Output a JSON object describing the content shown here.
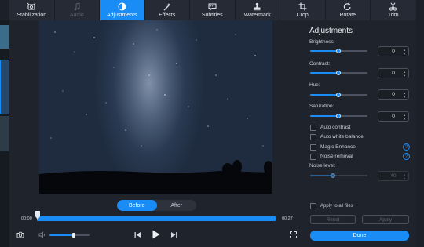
{
  "tabs": [
    {
      "label": "Stabilization",
      "icon": "stabilization-icon",
      "state": "normal"
    },
    {
      "label": "Audio",
      "icon": "music-note-icon",
      "state": "disabled"
    },
    {
      "label": "Adjustments",
      "icon": "adjustments-icon",
      "state": "active"
    },
    {
      "label": "Effects",
      "icon": "magic-wand-icon",
      "state": "normal"
    },
    {
      "label": "Subtitles",
      "icon": "speech-bubble-icon",
      "state": "normal"
    },
    {
      "label": "Watermark",
      "icon": "stamp-icon",
      "state": "normal"
    },
    {
      "label": "Crop",
      "icon": "crop-icon",
      "state": "normal"
    },
    {
      "label": "Rotate",
      "icon": "rotate-icon",
      "state": "normal"
    },
    {
      "label": "Trim",
      "icon": "scissors-icon",
      "state": "normal"
    }
  ],
  "preview": {
    "before_label": "Before",
    "after_label": "After",
    "selected": "Before"
  },
  "player": {
    "time_start": "00:00",
    "time_end": "00:27",
    "volume_level": 0.6
  },
  "adjustments": {
    "title": "Adjustments",
    "sliders": [
      {
        "label": "Brightness:",
        "value": "0",
        "level": 0.5
      },
      {
        "label": "Contrast:",
        "value": "0",
        "level": 0.5
      },
      {
        "label": "Hue:",
        "value": "0",
        "level": 0.5
      },
      {
        "label": "Saturation:",
        "value": "0",
        "level": 0.5
      }
    ],
    "checkboxes": [
      {
        "label": "Auto contrast",
        "checked": false,
        "help": false
      },
      {
        "label": "Auto white balance",
        "checked": false,
        "help": false
      },
      {
        "label": "Magic Enhance",
        "checked": false,
        "help": true
      },
      {
        "label": "Noise removal",
        "checked": false,
        "help": true
      }
    ],
    "noise_label": "Noise level:",
    "noise_value": "40",
    "noise_level": 0.4,
    "apply_all_label": "Apply to all files",
    "reset_label": "Reset",
    "apply_label": "Apply",
    "done_label": "Done"
  },
  "colors": {
    "accent": "#1a8cf5",
    "background": "#1f232c"
  }
}
